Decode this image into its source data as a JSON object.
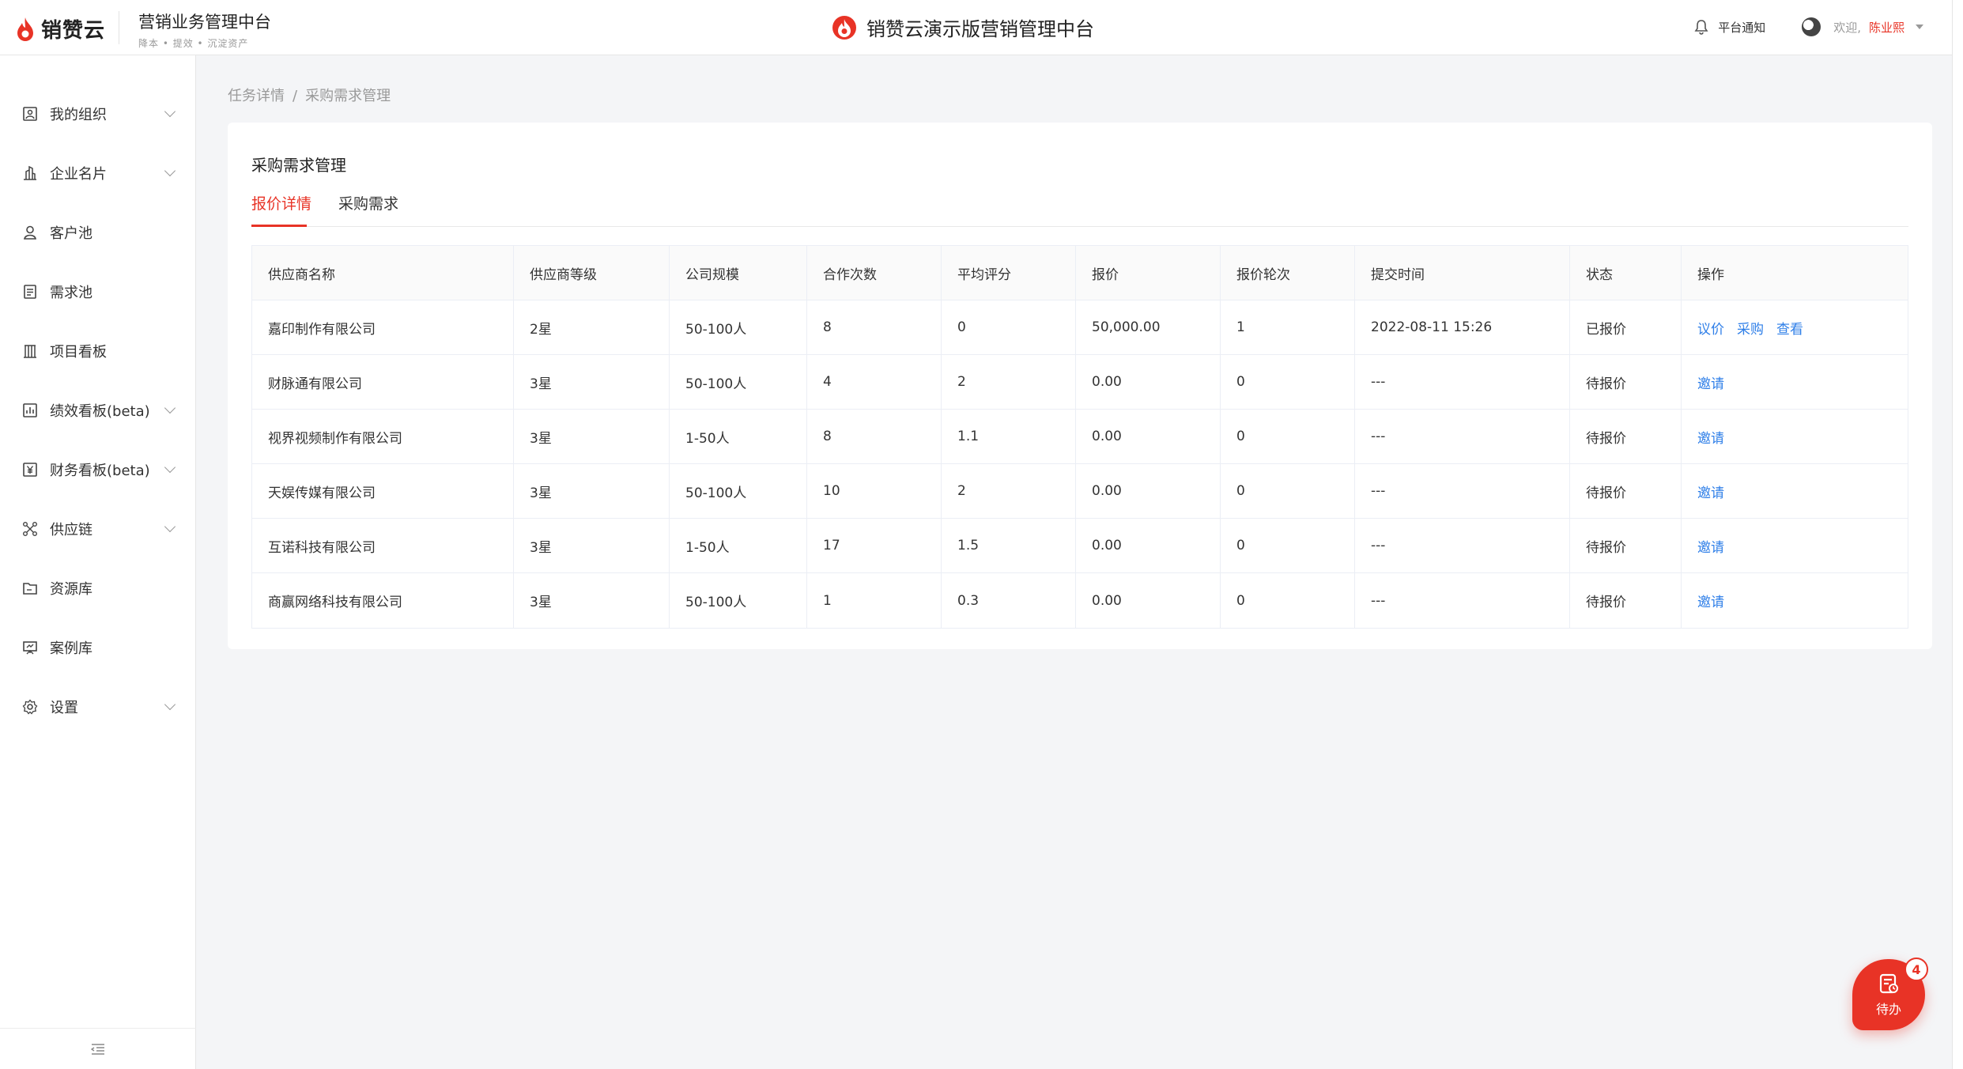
{
  "header": {
    "logo_text": "销赞云",
    "brand_title": "营销业务管理中台",
    "brand_sub": "降本 • 提效 • 沉淀资产",
    "center_title": "销赞云演示版营销管理中台",
    "notify_label": "平台通知",
    "welcome": "欢迎,",
    "username": "陈业熙"
  },
  "sidebar": {
    "items": [
      {
        "label": "我的组织",
        "icon": "org-icon",
        "chevron": true
      },
      {
        "label": "企业名片",
        "icon": "building-icon",
        "chevron": true
      },
      {
        "label": "客户池",
        "icon": "user-icon",
        "chevron": false
      },
      {
        "label": "需求池",
        "icon": "doc-icon",
        "chevron": false
      },
      {
        "label": "项目看板",
        "icon": "board-icon",
        "chevron": false
      },
      {
        "label": "绩效看板(beta)",
        "icon": "chart-icon",
        "chevron": true
      },
      {
        "label": "财务看板(beta)",
        "icon": "yen-icon",
        "chevron": true
      },
      {
        "label": "供应链",
        "icon": "network-icon",
        "chevron": true
      },
      {
        "label": "资源库",
        "icon": "folder-icon",
        "chevron": false
      },
      {
        "label": "案例库",
        "icon": "presentation-icon",
        "chevron": false
      },
      {
        "label": "设置",
        "icon": "gear-icon",
        "chevron": true
      }
    ]
  },
  "breadcrumb": {
    "items": [
      "任务详情",
      "采购需求管理"
    ],
    "separator": "/"
  },
  "card": {
    "title": "采购需求管理",
    "tabs": [
      {
        "label": "报价详情",
        "active": true
      },
      {
        "label": "采购需求",
        "active": false
      }
    ]
  },
  "table": {
    "headers": [
      "供应商名称",
      "供应商等级",
      "公司规模",
      "合作次数",
      "平均评分",
      "报价",
      "报价轮次",
      "提交时间",
      "状态",
      "操作"
    ],
    "rows": [
      {
        "cells": [
          "嘉印制作有限公司",
          "2星",
          "50-100人",
          "8",
          "0",
          "50,000.00",
          "1",
          "2022-08-11 15:26",
          "已报价"
        ],
        "actions": [
          "议价",
          "采购",
          "查看"
        ]
      },
      {
        "cells": [
          "财脉通有限公司",
          "3星",
          "50-100人",
          "4",
          "2",
          "0.00",
          "0",
          "---",
          "待报价"
        ],
        "actions": [
          "邀请"
        ]
      },
      {
        "cells": [
          "视界视频制作有限公司",
          "3星",
          "1-50人",
          "8",
          "1.1",
          "0.00",
          "0",
          "---",
          "待报价"
        ],
        "actions": [
          "邀请"
        ]
      },
      {
        "cells": [
          "天娱传媒有限公司",
          "3星",
          "50-100人",
          "10",
          "2",
          "0.00",
          "0",
          "---",
          "待报价"
        ],
        "actions": [
          "邀请"
        ]
      },
      {
        "cells": [
          "互诺科技有限公司",
          "3星",
          "1-50人",
          "17",
          "1.5",
          "0.00",
          "0",
          "---",
          "待报价"
        ],
        "actions": [
          "邀请"
        ]
      },
      {
        "cells": [
          "商赢网络科技有限公司",
          "3星",
          "50-100人",
          "1",
          "0.3",
          "0.00",
          "0",
          "---",
          "待报价"
        ],
        "actions": [
          "邀请"
        ]
      }
    ]
  },
  "todo": {
    "label": "待办",
    "badge": "4"
  },
  "colors": {
    "accent": "#e83326",
    "link": "#2f7fe8"
  }
}
